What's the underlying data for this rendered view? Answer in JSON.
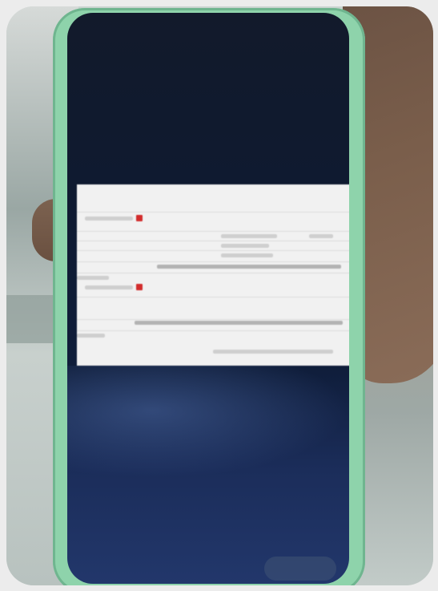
{
  "scene": {
    "subject": "phone",
    "device_color": "#8ed3ab",
    "screen_colors": [
      "#121a2b",
      "#22376b"
    ],
    "panel_color": "#f1f1f1",
    "accent_color": "#d22c2c"
  }
}
